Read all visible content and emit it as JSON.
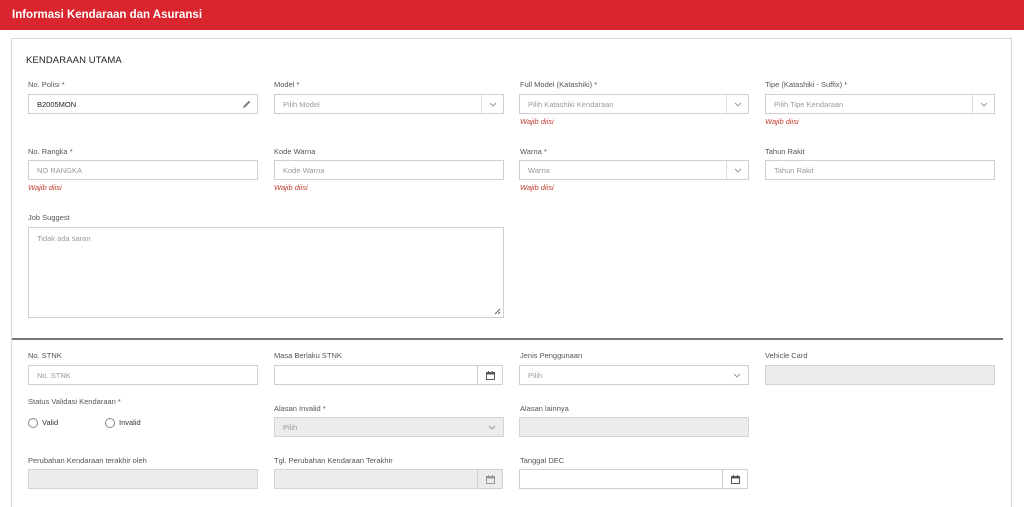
{
  "header": {
    "title": "Informasi Kendaraan dan Asuransi"
  },
  "section": {
    "title": "KENDARAAN UTAMA"
  },
  "no_polisi": {
    "label": "No. Polisi *",
    "value": "B2005MON"
  },
  "model": {
    "label": "Model *",
    "placeholder": "Pilih Model"
  },
  "full_model": {
    "label": "Full Model (Katashiki) *",
    "placeholder": "Pilih Katashiki Kendaraan",
    "hint": "Wajib diisi"
  },
  "tipe": {
    "label": "Tipe (Katashiki - Suffix) *",
    "placeholder": "Pilih Tipe Kendaraan",
    "hint": "Wajib diisi"
  },
  "no_rangka": {
    "label": "No. Rangka *",
    "placeholder": "NO RANGKA",
    "hint": "Wajib diisi"
  },
  "kode_warna": {
    "label": "Kode Warna",
    "placeholder": "Kode Warna",
    "hint": "Wajib diisi"
  },
  "warna": {
    "label": "Warna *",
    "placeholder": "Warna",
    "hint": "Wajib diisi"
  },
  "tahun_rakit": {
    "label": "Tahun Rakit",
    "placeholder": "Tahun Rakit"
  },
  "job_suggest": {
    "label": "Job Suggest",
    "placeholder": "Tidak ada saran"
  },
  "no_stnk": {
    "label": "No. STNK",
    "placeholder": "No. STNK"
  },
  "masa_berlaku": {
    "label": "Masa Berlaku STNK"
  },
  "jenis_penggunaan": {
    "label": "Jenis Penggunaan",
    "placeholder": "Pilih"
  },
  "vehicle_card": {
    "label": "Vehicle Card"
  },
  "status_validasi": {
    "label": "Status Validasi Kendaraan *",
    "option_valid": "Valid",
    "option_invalid": "Invalid"
  },
  "alasan_invalid": {
    "label": "Alasan Invalid *",
    "placeholder": "Pilih"
  },
  "alasan_lainnya": {
    "label": "Alasan lainnya"
  },
  "perubahan_oleh": {
    "label": "Perubahan Kendaraan terakhir oleh"
  },
  "tgl_perubahan": {
    "label": "Tgl. Perubahan Kendaraan Terakhir"
  },
  "tanggal_dec": {
    "label": "Tanggal DEC"
  },
  "colors": {
    "header_bg": "#d9262e",
    "hint": "#c0392b",
    "disabled_bg": "#ececec"
  },
  "icons": [
    "pencil-icon",
    "chevron-down-icon",
    "calendar-icon",
    "resize-handle-icon"
  ]
}
